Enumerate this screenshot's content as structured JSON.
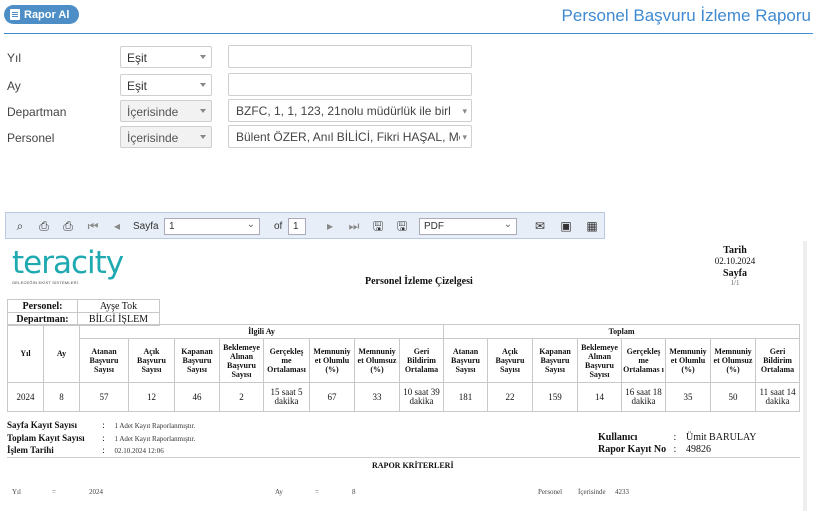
{
  "header": {
    "report_button": "Rapor Al",
    "title": "Personel Başvuru İzleme Raporu"
  },
  "filters": [
    {
      "label": "Yıl",
      "operator": "Eşit",
      "value": ""
    },
    {
      "label": "Ay",
      "operator": "Eşit",
      "value": ""
    },
    {
      "label": "Departman",
      "operator": "İçerisinde",
      "value": "BZFC, 1, 1, 123, 21nolu müdürlük ile birl"
    },
    {
      "label": "Personel",
      "operator": "İçerisinde",
      "value": "Bülent ÖZER, Anıl BİLİCİ, Fikri HAŞAL, Me"
    }
  ],
  "toolbar": {
    "page_label": "Sayfa",
    "page_value": "1",
    "of_label": "of",
    "page_total": "1",
    "export_format": "PDF"
  },
  "report": {
    "logo_text": "teracity",
    "logo_tagline": "GELECEĞİN EKİST SİSTEMLERİ",
    "title": "Personel İzleme Çizelgesi",
    "date_label": "Tarih",
    "date_value": "02.10.2024",
    "page_label": "Sayfa",
    "page_value": "1/1",
    "personel_label": "Personel:",
    "personel_value": "Ayşe Tok",
    "departman_label": "Departman:",
    "departman_value": "BİLGİ İŞLEM",
    "group_related": "İlgili Ay",
    "group_total": "Toplam",
    "col_yil": "Yıl",
    "col_ay": "Ay",
    "sub_headers": [
      "Atanan Başvuru Sayısı",
      "Açık Başvuru Sayısı",
      "Kapanan Başvuru Sayısı",
      "Beklemeye Alınan Başvuru Sayısı",
      "Gerçekleş me Ortalaması",
      "Memnuniy et Olumlu (%)",
      "Memnuniy et Olumsuz (%)",
      "Geri Bildirim Ortalama"
    ],
    "sub_headers_total": [
      "Atanan Başvuru Sayısı",
      "Açık Başvuru Sayısı",
      "Kapanan Başvuru Sayısı",
      "Beklemeye Alınan Başvuru Sayısı",
      "Gerçekleş me Ortalamas ı",
      "Memnuniy et Olumlu (%)",
      "Memnuniy et Olumsuz (%)",
      "Geri Bildirim Ortalama"
    ],
    "row": {
      "yil": "2024",
      "ay": "8",
      "related": [
        "57",
        "12",
        "46",
        "2",
        "15 saat 5 dakika",
        "67",
        "33",
        "10 saat 39 dakika"
      ],
      "total": [
        "181",
        "22",
        "159",
        "14",
        "16 saat 18 dakika",
        "35",
        "50",
        "11 saat 14 dakika"
      ]
    },
    "footer": {
      "sayfa_kayit_label": "Sayfa Kayıt Sayısı",
      "sayfa_kayit_value": "1 Adet Kayıt Raporlanmıştır.",
      "toplam_kayit_label": "Toplam Kayıt Sayısı",
      "toplam_kayit_value": "1 Adet Kayıt Raporlanmıştır.",
      "islem_tarihi_label": "İşlem Tarihi",
      "islem_tarihi_value": "02.10.2024 12:06",
      "kullanici_label": "Kullanıcı",
      "kullanici_value": "Ümit BARULAY",
      "rapor_kayit_label": "Rapor Kayıt No",
      "rapor_kayit_value": "49826",
      "colon": ":"
    },
    "criteria_title": "RAPOR KRİTERLERİ",
    "criteria": {
      "yil_label": "Yıl",
      "yil_op": "=",
      "yil_value": "2024",
      "ay_label": "Ay",
      "ay_op": "=",
      "ay_value": "8",
      "personel_label": "Personel",
      "personel_op": "İçerisinde",
      "personel_value": "4233"
    }
  }
}
